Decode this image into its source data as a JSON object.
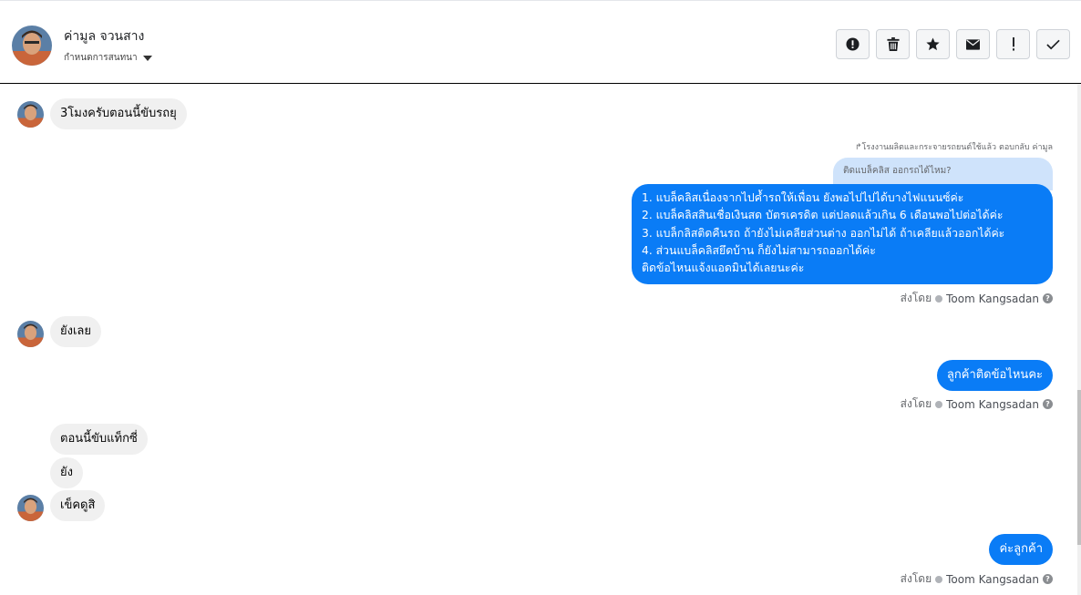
{
  "header": {
    "contact_name": "ค่ามูล จวนสาง",
    "conversation_menu_label": "กำหนดการสนทนา"
  },
  "toolbar": {
    "buttons": [
      "alert-circle-icon",
      "trash-icon",
      "star-icon",
      "envelope-icon",
      "exclamation-icon",
      "check-icon"
    ]
  },
  "messages": {
    "in_1": "3โมงครับตอนนี้ขับรถยุ",
    "reply_note": "↱โรงงานผลิตและกระจายรถยนต์ใช้แล้ว ตอบกลับ ค่ามูล",
    "reply_quote": "ติดแบล็คลิส ออกรถได้ไหม?",
    "out_list": [
      "1. แบล็คลิสเนื่องจากไปค้ำรถให้เพื่อน ยังพอไปไปได้บางไฟแนนซ์ค่ะ",
      "2. แบล็คลิสสินเชื่อเงินสด บัตรเครดิต แต่ปลดแล้วเกิน 6 เดือนพอไปต่อได้ค่ะ",
      "3. แบล็กลิสติดคืนรถ ถ้ายังไม่เคลียส่วนต่าง ออกไม่ได้ ถ้าเคลียแล้วออกได้ค่ะ",
      "4. ส่วนแบล็คลิสยึดบ้าน ก็ยังไม่สามารถออกได้ค่ะ",
      "  ติดข้อไหนแจ้งแอดมินได้เลยนะค่ะ"
    ],
    "in_2": "ยังเลย",
    "out_2": "ลูกค้าติดข้อไหนคะ",
    "in_3": "ตอนนี้ขับแท็กซี่",
    "in_4": "ยัง",
    "in_5": "เข็คดูสิ",
    "out_3": "ค่ะลูกค้า"
  },
  "sent_by": {
    "label": "ส่งโดย",
    "agent": "Toom Kangsadan"
  },
  "colors": {
    "outgoing_bubble": "#0a7cf6",
    "incoming_bubble": "#f0f0f0",
    "reply_quote_bg": "#cfe3fb"
  }
}
